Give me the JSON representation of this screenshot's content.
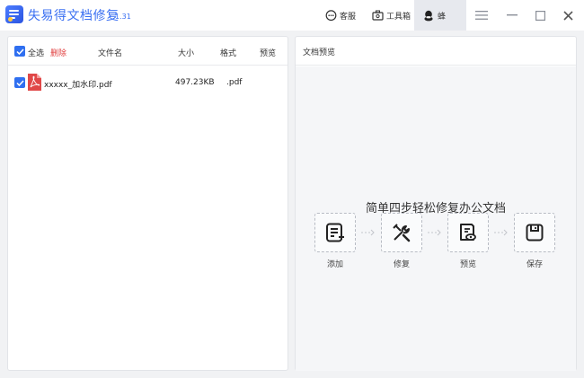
{
  "app": {
    "title": "失易得文档修复",
    "version": "1.31"
  },
  "titlebar": {
    "service_label": "客服",
    "toolbox_label": "工具箱",
    "user_name": "蜂"
  },
  "file_list": {
    "select_all_label": "全选",
    "delete_label": "删除",
    "columns": {
      "name": "文件名",
      "size": "大小",
      "format": "格式",
      "preview": "预览"
    },
    "rows": [
      {
        "name": "xxxxx_加水印.pdf",
        "size": "497.23KB",
        "format": ".pdf",
        "checked": true
      }
    ]
  },
  "preview": {
    "title": "文档预览",
    "headline": "简单四步轻松修复办公文档",
    "steps": [
      {
        "label": "添加",
        "icon": "add-document-icon"
      },
      {
        "label": "修复",
        "icon": "repair-tools-icon"
      },
      {
        "label": "预览",
        "icon": "preview-document-icon"
      },
      {
        "label": "保存",
        "icon": "save-disk-icon"
      }
    ]
  },
  "colors": {
    "accent": "#3a6ff2",
    "checkbox": "#2f6ff0",
    "delete": "#e03d3d",
    "pdf_red": "#e04848"
  }
}
